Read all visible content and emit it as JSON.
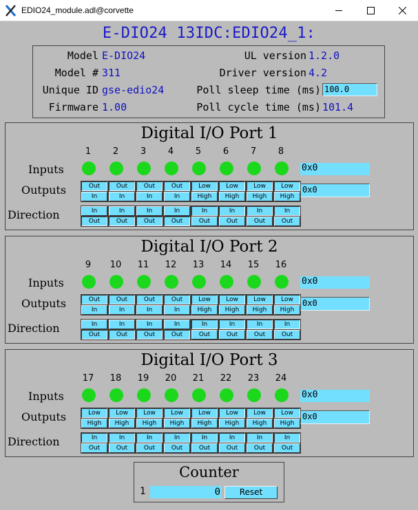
{
  "window": {
    "title": "EDIO24_module.adl@corvette"
  },
  "header": {
    "title": "E-DIO24  13IDC:EDIO24_1:"
  },
  "info": {
    "model_label": "Model",
    "model_value": "E-DIO24",
    "model_num_label": "Model #",
    "model_num_value": "311",
    "unique_id_label": "Unique ID",
    "unique_id_value": "gse-edio24",
    "firmware_label": "Firmware",
    "firmware_value": "1.00",
    "ul_version_label": "UL version",
    "ul_version_value": "1.2.0",
    "driver_version_label": "Driver version",
    "driver_version_value": "4.2",
    "poll_sleep_label": "Poll sleep time (ms)",
    "poll_sleep_value": "100.0",
    "poll_cycle_label": "Poll cycle time (ms)",
    "poll_cycle_value": "101.4"
  },
  "row_labels": {
    "inputs": "Inputs",
    "outputs": "Outputs",
    "direction": "Direction"
  },
  "ports": [
    {
      "title": "Digital I/O Port 1",
      "channels": [
        "1",
        "2",
        "3",
        "4",
        "5",
        "6",
        "7",
        "8"
      ],
      "input_value": "0x0",
      "output_value": "0x0",
      "outputs": [
        [
          "Out",
          "In"
        ],
        [
          "Out",
          "In"
        ],
        [
          "Out",
          "In"
        ],
        [
          "Out",
          "In"
        ],
        [
          "Low",
          "High"
        ],
        [
          "Low",
          "High"
        ],
        [
          "Low",
          "High"
        ],
        [
          "Low",
          "High"
        ]
      ],
      "output_selected": [
        0,
        0,
        0,
        0,
        0,
        0,
        0,
        0
      ],
      "direction": [
        [
          "In",
          "Out"
        ],
        [
          "In",
          "Out"
        ],
        [
          "In",
          "Out"
        ],
        [
          "In",
          "Out"
        ],
        [
          "In",
          "Out"
        ],
        [
          "In",
          "Out"
        ],
        [
          "In",
          "Out"
        ],
        [
          "In",
          "Out"
        ]
      ],
      "direction_selected": [
        1,
        1,
        1,
        1,
        0,
        0,
        0,
        0
      ]
    },
    {
      "title": "Digital I/O Port 2",
      "channels": [
        "9",
        "10",
        "11",
        "12",
        "13",
        "14",
        "15",
        "16"
      ],
      "input_value": "0x0",
      "output_value": "0x0",
      "outputs": [
        [
          "Out",
          "In"
        ],
        [
          "Out",
          "In"
        ],
        [
          "Out",
          "In"
        ],
        [
          "Out",
          "In"
        ],
        [
          "Low",
          "High"
        ],
        [
          "Low",
          "High"
        ],
        [
          "Low",
          "High"
        ],
        [
          "Low",
          "High"
        ]
      ],
      "output_selected": [
        0,
        0,
        0,
        0,
        0,
        0,
        0,
        0
      ],
      "direction": [
        [
          "In",
          "Out"
        ],
        [
          "In",
          "Out"
        ],
        [
          "In",
          "Out"
        ],
        [
          "In",
          "Out"
        ],
        [
          "In",
          "Out"
        ],
        [
          "In",
          "Out"
        ],
        [
          "In",
          "Out"
        ],
        [
          "In",
          "Out"
        ]
      ],
      "direction_selected": [
        1,
        1,
        1,
        1,
        0,
        0,
        0,
        0
      ]
    },
    {
      "title": "Digital I/O Port 3",
      "channels": [
        "17",
        "18",
        "19",
        "20",
        "21",
        "22",
        "23",
        "24"
      ],
      "input_value": "0x0",
      "output_value": "0x0",
      "outputs": [
        [
          "Low",
          "High"
        ],
        [
          "Low",
          "High"
        ],
        [
          "Low",
          "High"
        ],
        [
          "Low",
          "High"
        ],
        [
          "Low",
          "High"
        ],
        [
          "Low",
          "High"
        ],
        [
          "Low",
          "High"
        ],
        [
          "Low",
          "High"
        ]
      ],
      "output_selected": [
        0,
        0,
        0,
        0,
        0,
        0,
        0,
        0
      ],
      "direction": [
        [
          "In",
          "Out"
        ],
        [
          "In",
          "Out"
        ],
        [
          "In",
          "Out"
        ],
        [
          "In",
          "Out"
        ],
        [
          "In",
          "Out"
        ],
        [
          "In",
          "Out"
        ],
        [
          "In",
          "Out"
        ],
        [
          "In",
          "Out"
        ]
      ],
      "direction_selected": [
        0,
        0,
        0,
        0,
        0,
        0,
        0,
        0
      ]
    }
  ],
  "counter": {
    "title": "Counter",
    "index": "1",
    "value": "0",
    "reset_label": "Reset"
  },
  "colors": {
    "background": "#bbbbbb",
    "control": "#73dfff",
    "led_on": "#1cd81c",
    "value_text": "#1010c0"
  }
}
